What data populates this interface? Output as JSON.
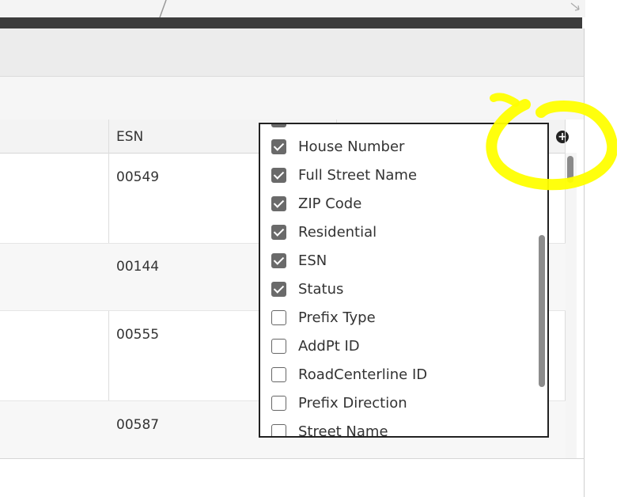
{
  "grid": {
    "esn_header": "ESN",
    "rows": [
      {
        "esn": "00549"
      },
      {
        "esn": "00144"
      },
      {
        "esn": "00555"
      },
      {
        "esn": "00587"
      }
    ],
    "add_column_icon": "plus-circle-icon"
  },
  "column_menu": {
    "items": [
      {
        "label": "House Number",
        "checked": true
      },
      {
        "label": "Full Street Name",
        "checked": true
      },
      {
        "label": "ZIP Code",
        "checked": true
      },
      {
        "label": "Residential",
        "checked": true
      },
      {
        "label": "ESN",
        "checked": true
      },
      {
        "label": "Status",
        "checked": true
      },
      {
        "label": "Prefix Type",
        "checked": false
      },
      {
        "label": "AddPt ID",
        "checked": false
      },
      {
        "label": "RoadCenterline ID",
        "checked": false
      },
      {
        "label": "Prefix Direction",
        "checked": false
      },
      {
        "label": "Street Name",
        "checked": false
      }
    ]
  },
  "annotation": {
    "highlight_color": "#ffff00"
  }
}
